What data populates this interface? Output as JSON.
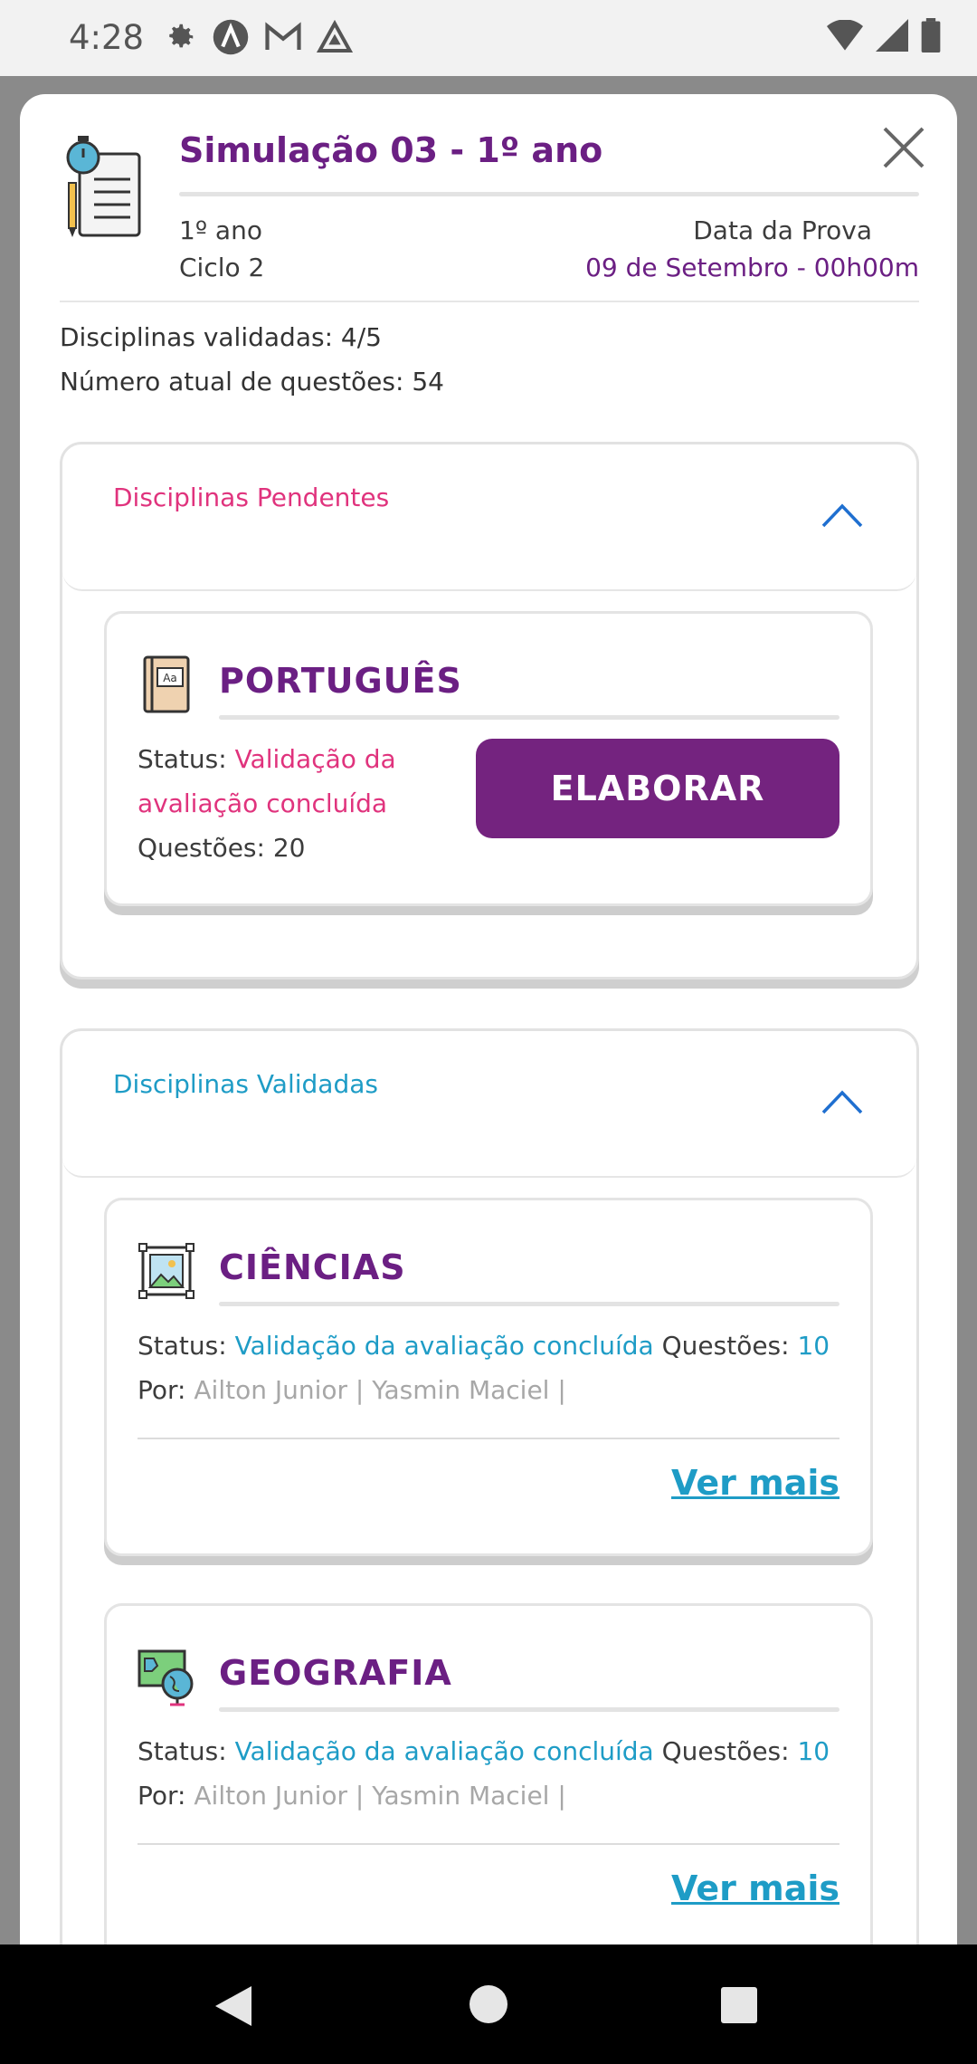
{
  "status_bar": {
    "time": "4:28",
    "icons": [
      "gear-icon",
      "a-circle-icon",
      "gmail-icon",
      "triangle-icon"
    ],
    "right_icons": [
      "wifi-icon",
      "signal-icon",
      "battery-icon"
    ]
  },
  "header": {
    "title": "Simulação 03 - 1º ano",
    "grade": "1º ano",
    "cycle": "Ciclo 2",
    "exam_date_label": "Data da Prova",
    "exam_date_value": "09 de Setembro - 00h00m"
  },
  "stats": {
    "validated": "Disciplinas validadas: 4/5",
    "questions": "Número atual de questões: 54"
  },
  "pending_section": {
    "title": "Disciplinas Pendentes",
    "title_color": "#e0337d",
    "card": {
      "subject": "PORTUGUÊS",
      "status_label": "Status:",
      "status_line1": "Validação da",
      "status_line2": "avaliação concluída",
      "questions": "Questões: 20",
      "button": "ELABORAR"
    }
  },
  "validated_section": {
    "title": "Disciplinas Validadas",
    "title_color": "#1e9cc6",
    "cards": [
      {
        "subject": "CIÊNCIAS",
        "status_label": "Status:",
        "status": "Validação da avaliação concluída",
        "questions_label": "Questões:",
        "questions": "10",
        "by_label": "Por:",
        "by": "Ailton Junior | Yasmin Maciel |",
        "link": "Ver mais"
      },
      {
        "subject": "GEOGRAFIA",
        "status_label": "Status:",
        "status": "Validação da avaliação concluída",
        "questions_label": "Questões:",
        "questions": "10",
        "by_label": "Por:",
        "by": "Ailton Junior | Yasmin Maciel |",
        "link": "Ver mais"
      }
    ]
  },
  "colors": {
    "brand_purple": "#6b1f83",
    "button_purple": "#74237f",
    "pink": "#e0337d",
    "cyan": "#1e9cc6"
  }
}
